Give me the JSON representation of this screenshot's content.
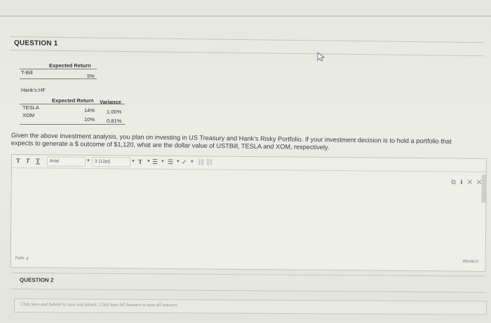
{
  "question": {
    "title": "QUESTION 1",
    "tbill": {
      "label": "T-Bill",
      "header": "Expected Return",
      "value": "5%"
    },
    "hanks_hf": {
      "label": "Hank's HF",
      "header_return": "Expected Return",
      "header_variance": "Variance",
      "rows": [
        {
          "name": "TESLA",
          "ret": "14%",
          "var": "1.00%"
        },
        {
          "name": "XOM",
          "ret": "10%",
          "var": "0.81%"
        }
      ]
    },
    "text_line1": "Given the above investment analysis, you plan on investing in US Treasury and Hank's Risky Portfolio. If your investment decision is to hold a portfolio that",
    "text_line2": "expects to generate a $ outcome of $1,120, what are the dollar value of USTBill, TESLA and XOM, respectively."
  },
  "editor": {
    "format_t1": "T",
    "format_t2": "T",
    "format_t3": "T",
    "font_family": "Arial",
    "font_size": "3 (12pt)",
    "text_color_btn": "T",
    "list_btn": "☰",
    "indent_btn": "☰",
    "path_label": "Path: p",
    "words_label": "Words:0",
    "right_icons": "⧉ ℹ ✕ ✕"
  },
  "question2": {
    "title": "QUESTION 2"
  },
  "footer": {
    "text": "Click Save and Submit to save and submit. Click Save All Answers to save all answers."
  },
  "colors": {
    "page_bg": "#dcdcd6",
    "border": "#c4c4be",
    "text": "#2b2b2b"
  }
}
